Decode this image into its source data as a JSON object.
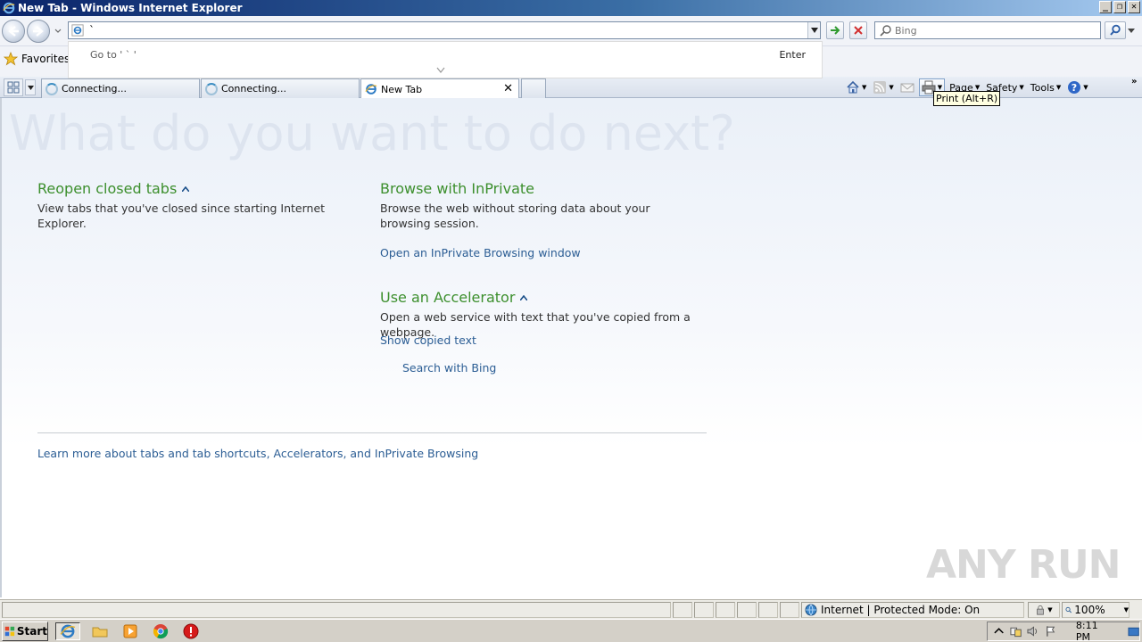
{
  "window": {
    "title": "New Tab - Windows Internet Explorer"
  },
  "nav": {
    "address_value": "`",
    "search_placeholder": "Bing"
  },
  "autocomplete": {
    "goto_text": "Go to ' ` '",
    "enter_label": "Enter"
  },
  "favorites": {
    "label": "Favorites"
  },
  "tabs": [
    {
      "label": "Connecting...",
      "state": "loading"
    },
    {
      "label": "Connecting...",
      "state": "loading"
    },
    {
      "label": "New Tab",
      "state": "active"
    }
  ],
  "command_bar": {
    "page_label": "Page",
    "safety_label": "Safety",
    "tools_label": "Tools",
    "print_tooltip": "Print (Alt+R)"
  },
  "page": {
    "headline": "What do you want to do next?",
    "reopen": {
      "heading": "Reopen closed tabs",
      "desc": "View tabs that you've closed since starting Internet Explorer."
    },
    "inprivate": {
      "heading": "Browse with InPrivate",
      "desc": "Browse the web without storing data about your browsing session.",
      "link": "Open an InPrivate Browsing window"
    },
    "accelerator": {
      "heading": "Use an Accelerator",
      "desc": "Open a web service with text that you've copied from a webpage.",
      "link_show": "Show copied text",
      "link_search": "Search with Bing"
    },
    "learn_more": "Learn more about tabs and tab shortcuts, Accelerators, and InPrivate Browsing"
  },
  "status": {
    "zone": "Internet | Protected Mode: On",
    "zoom": "100%"
  },
  "taskbar": {
    "start_label": "Start",
    "clock": "8:11 PM"
  },
  "watermark": {
    "text": "ANY RUN"
  },
  "colors": {
    "heading_green": "#3c8f2d",
    "link_blue": "#2b5d94",
    "title_gradient_start": "#0a246a"
  }
}
